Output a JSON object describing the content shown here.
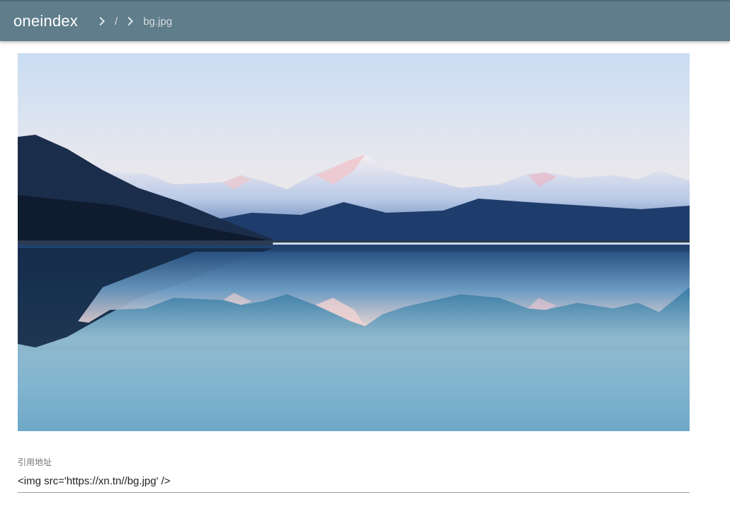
{
  "header": {
    "title": "oneindex",
    "breadcrumb": [
      {
        "label": "/"
      },
      {
        "label": "bg.jpg"
      }
    ],
    "bar_color": "#607d8b"
  },
  "preview": {
    "image_description_icon": "image-preview",
    "alt": "bg.jpg"
  },
  "embed": {
    "label": "引用地址",
    "value": "<img src='https://xn.tn//bg.jpg' />"
  }
}
